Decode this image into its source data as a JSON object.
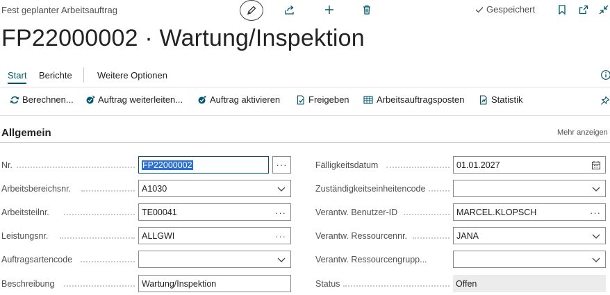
{
  "header": {
    "page_type": "Fest geplanter Arbeitsauftrag",
    "saved_label": "Gespeichert"
  },
  "title": "FP22000002 · Wartung/Inspektion",
  "tabs": [
    {
      "label": "Start",
      "active": true
    },
    {
      "label": "Berichte"
    },
    {
      "label": "Weitere Optionen"
    }
  ],
  "actions": [
    {
      "label": "Berechnen...",
      "icon": "refresh-icon"
    },
    {
      "label": "Auftrag weiterleiten...",
      "icon": "forward-icon"
    },
    {
      "label": "Auftrag aktivieren",
      "icon": "activate-icon"
    },
    {
      "label": "Freigeben",
      "icon": "release-icon"
    },
    {
      "label": "Arbeitsauftragsposten",
      "icon": "lines-icon"
    },
    {
      "label": "Statistik",
      "icon": "statistics-icon"
    }
  ],
  "section": {
    "title": "Allgemein",
    "more_label": "Mehr anzeigen"
  },
  "left_fields": [
    {
      "label": "Nr.",
      "value": "FP22000002",
      "control": "lookup"
    },
    {
      "label": "Arbeitsbereichsnr.",
      "value": "A1030",
      "control": "dropdown"
    },
    {
      "label": "Arbeitsteilnr.",
      "value": "TE00041",
      "control": "ellipsis"
    },
    {
      "label": "Leistungsnr.",
      "value": "ALLGWI",
      "control": "ellipsis"
    },
    {
      "label": "Auftragsartencode",
      "value": "",
      "control": "dropdown"
    },
    {
      "label": "Beschreibung",
      "value": "Wartung/Inspektion",
      "control": "text"
    }
  ],
  "right_fields": [
    {
      "label": "Fälligkeitsdatum",
      "value": "01.01.2027",
      "control": "date"
    },
    {
      "label": "Zuständigkeitseinheitencode",
      "value": "",
      "control": "dropdown"
    },
    {
      "label": "Verantw. Benutzer-ID",
      "value": "MARCEL.KLOPSCH",
      "control": "ellipsis"
    },
    {
      "label": "Verantw. Ressourcennr.",
      "value": "JANA",
      "control": "dropdown"
    },
    {
      "label": "Verantw. Ressourcengrupp...",
      "value": "",
      "control": "dropdown"
    },
    {
      "label": "Status",
      "value": "Offen",
      "control": "readonly"
    }
  ],
  "colors": {
    "accent": "#00566d",
    "selection": "#2a6fd6"
  }
}
